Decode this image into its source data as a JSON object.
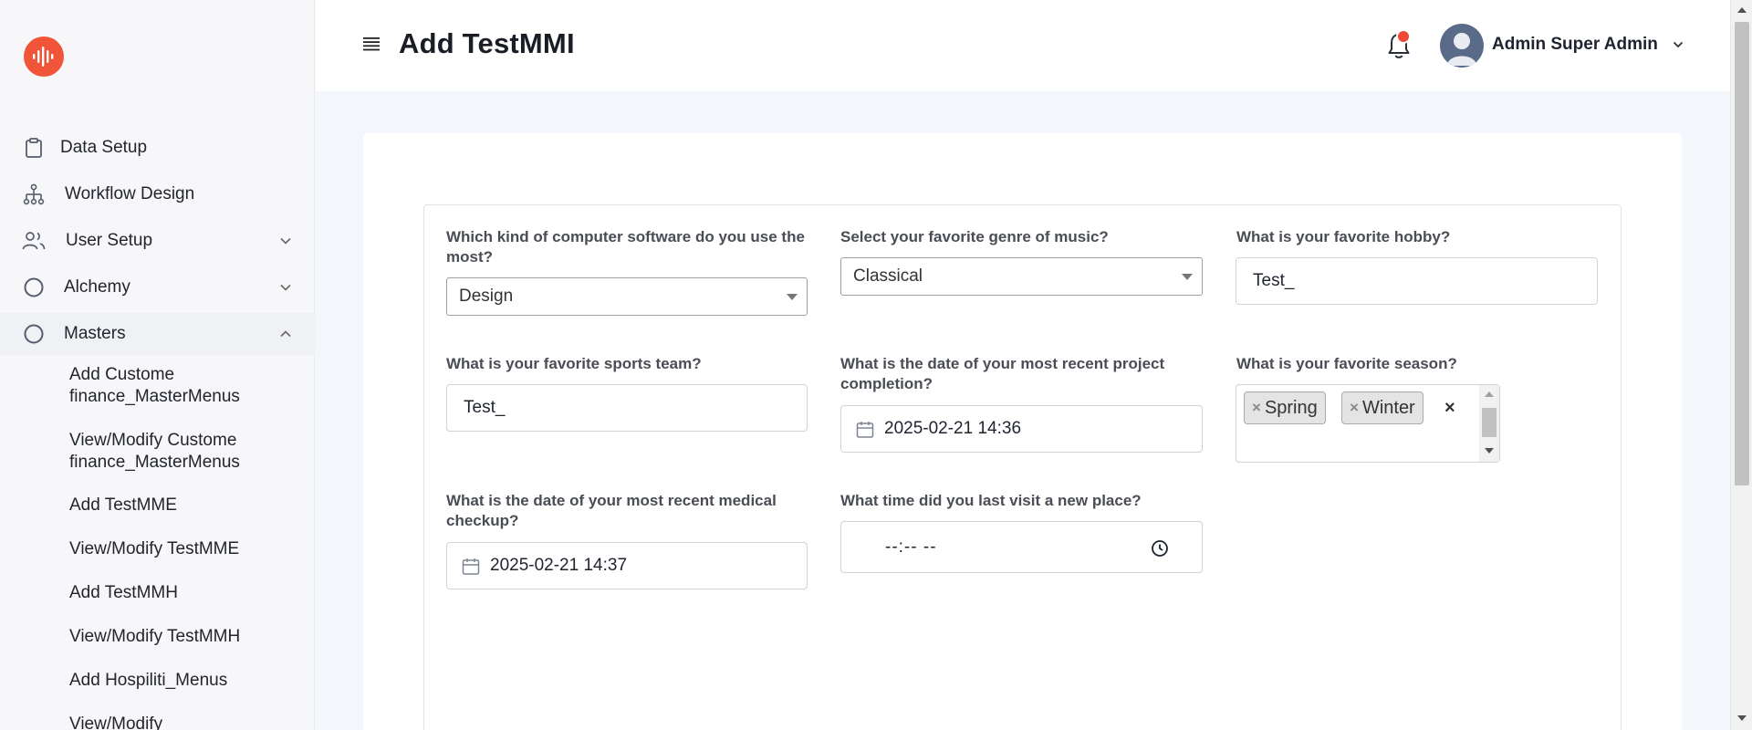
{
  "app": {
    "title": "Add TestMMI",
    "brand_color": "#f0553a"
  },
  "header": {
    "user_name": "Admin Super Admin",
    "notification_dot_color": "#ef4836"
  },
  "sidebar": {
    "items": [
      {
        "label": "Data Setup",
        "icon": "clipboard-icon"
      },
      {
        "label": "Workflow Design",
        "icon": "hierarchy-icon"
      },
      {
        "label": "User Setup",
        "icon": "users-icon",
        "expandable": true
      },
      {
        "label": "Alchemy",
        "icon": "circle-icon",
        "expandable": true
      },
      {
        "label": "Masters",
        "icon": "circle-icon",
        "expandable": true,
        "expanded": true
      }
    ],
    "sub_items": [
      {
        "label": "Add Custome finance_MasterMenus"
      },
      {
        "label": "View/Modify Custome finance_MasterMenus"
      },
      {
        "label": "Add TestMME"
      },
      {
        "label": "View/Modify TestMME"
      },
      {
        "label": "Add TestMMH"
      },
      {
        "label": "View/Modify TestMMH"
      },
      {
        "label": "Add Hospiliti_Menus"
      },
      {
        "label": "View/Modify"
      }
    ]
  },
  "form": {
    "software": {
      "label": "Which kind of computer software do you use the most?",
      "value": "Design"
    },
    "music": {
      "label": "Select your favorite genre of music?",
      "value": "Classical"
    },
    "hobby": {
      "label": "What is your favorite hobby?",
      "value": "Test_"
    },
    "sports": {
      "label": "What is your favorite sports team?",
      "value": "Test_"
    },
    "project_date": {
      "label": "What is the date of your most recent project completion?",
      "value": "2025-02-21 14:36"
    },
    "season": {
      "label": "What is your favorite season?",
      "chips": [
        "Spring",
        "Winter"
      ],
      "clear": "×",
      "chip_remove": "×"
    },
    "medical_date": {
      "label": "What is the date of your most recent medical checkup?",
      "value": "2025-02-21 14:37"
    },
    "visit_time": {
      "label": "What time did you last visit a new place?",
      "value": "--:-- --"
    }
  }
}
